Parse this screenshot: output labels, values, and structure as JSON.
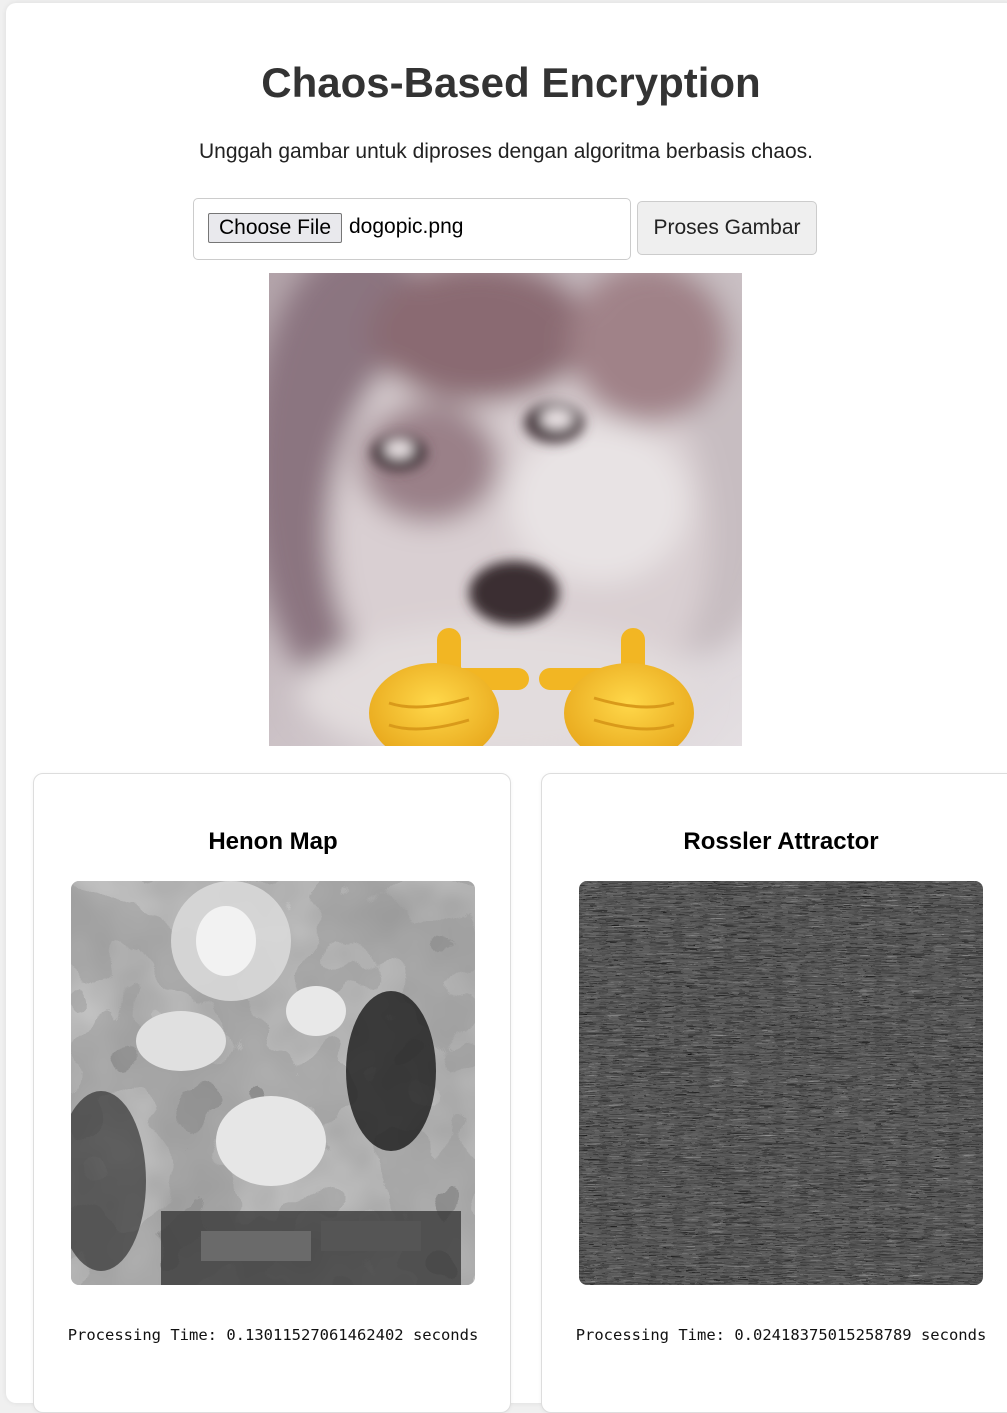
{
  "header": {
    "title": "Chaos-Based Encryption",
    "subtitle": "Unggah gambar untuk diproses dengan algoritma berbasis chaos."
  },
  "upload": {
    "choose_label": "Choose File",
    "file_name": "dogopic.png",
    "process_label": "Proses Gambar"
  },
  "results": [
    {
      "title": "Henon Map",
      "time_label": "Processing Time: 0.13011527061462402 seconds"
    },
    {
      "title": "Rossler Attractor",
      "time_label": "Processing Time: 0.02418375015258789 seconds"
    }
  ],
  "colors": {
    "title": "#333333",
    "card_background": "#ffffff",
    "page_background": "#f0f0f0",
    "emoji_yellow": "#f6c22e"
  },
  "icons": [
    "pointing-hand-emoji"
  ]
}
